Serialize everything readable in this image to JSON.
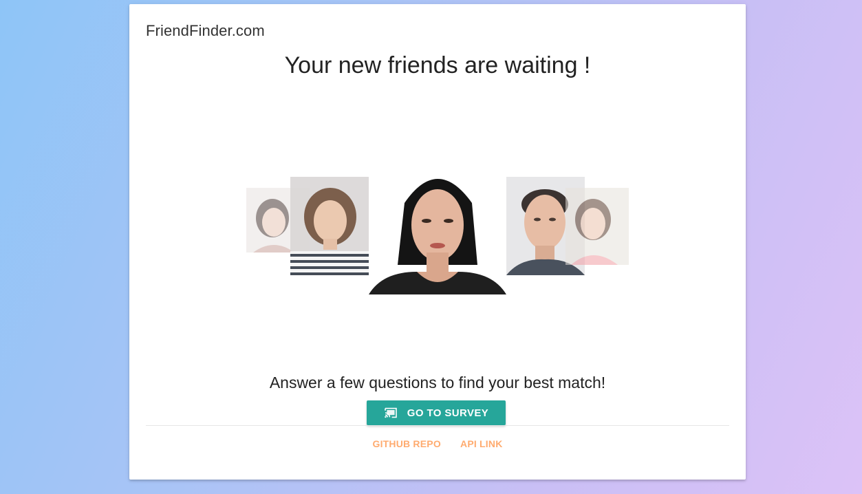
{
  "brand": {
    "name": "FriendFinder.com"
  },
  "hero": {
    "headline": "Your new friends are waiting !",
    "photos": [
      {
        "id": "far-left",
        "subject": "woman-dark-hair"
      },
      {
        "id": "left",
        "subject": "woman-bob-striped-shirt"
      },
      {
        "id": "center",
        "subject": "woman-long-black-hair"
      },
      {
        "id": "right",
        "subject": "man-short-hair"
      },
      {
        "id": "far-right",
        "subject": "woman-smiling"
      }
    ]
  },
  "cta": {
    "tagline": "Answer a few questions to find your best match!",
    "button_label": "GO TO SURVEY",
    "button_icon": "cast-icon",
    "button_color": "#26a69a"
  },
  "footer": {
    "links": [
      {
        "label": "GITHUB REPO"
      },
      {
        "label": "API LINK"
      }
    ],
    "link_color": "#ffab6f"
  }
}
